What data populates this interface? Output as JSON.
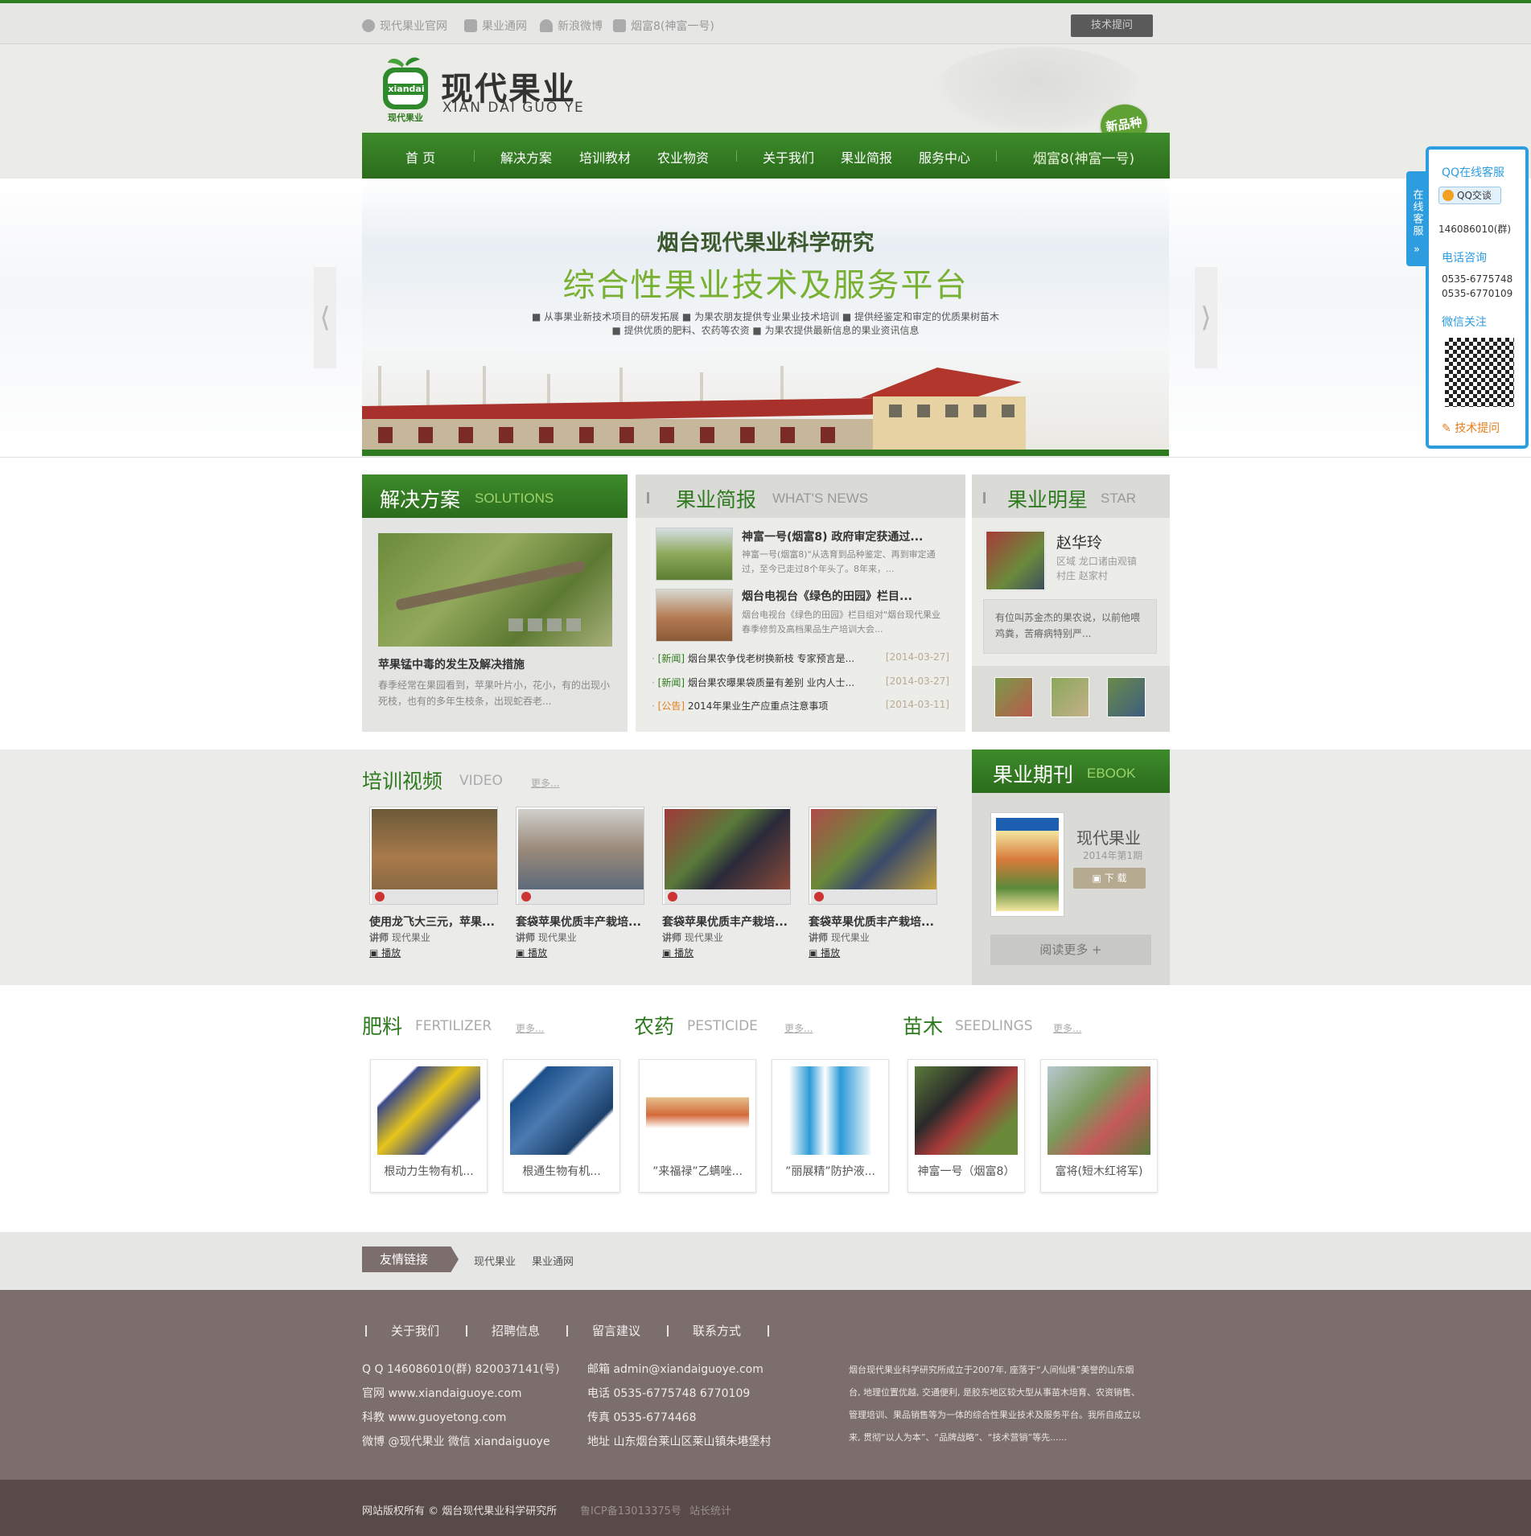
{
  "topbar": {
    "links": [
      "现代果业官网",
      "果业通网",
      "新浪微博",
      "烟富8(神富一号)"
    ],
    "tech_button": "技术提问"
  },
  "header": {
    "logo_mark": "xiandai",
    "logo_mark_sub": "现代果业",
    "logo_title": "现代果业",
    "logo_subtitle": "XIAN DAI GUO YE",
    "badge": "新品种"
  },
  "nav": {
    "items": [
      "首 页",
      "解决方案",
      "培训教材",
      "农业物资",
      "关于我们",
      "果业简报",
      "服务中心"
    ],
    "featured": "烟富8(神富一号)"
  },
  "banner": {
    "title": "烟台现代果业科学研究",
    "headline": "综合性果业技术及服务平台",
    "line1": "■ 从事果业新技术项目的研发拓展   ■ 为果农朋友提供专业果业技术培训   ■ 提供经鉴定和审定的优质果树苗木",
    "line2": "■ 提供优质的肥料、农药等农资   ■ 为果农提供最新信息的果业资讯信息",
    "prev": "⟨",
    "next": "⟩"
  },
  "solutions": {
    "title": "解决方案",
    "en": "SOLUTIONS",
    "article_title": "苹果锰中毒的发生及解决措施",
    "article_desc": "春季经常在果园看到，苹果叶片小，花小，有的出现小死枝，也有的多年生枝条，出现蛇吞老..."
  },
  "news": {
    "title": "果业简报",
    "en": "WHAT'S NEWS",
    "featured": [
      {
        "title": "神富一号(烟富8) 政府审定获通过...",
        "desc": "神富一号(烟富8)\"从选育到品种鉴定、再到审定通过，至今已走过8个年头了。8年来，..."
      },
      {
        "title": "烟台电视台《绿色的田园》栏目...",
        "desc": "烟台电视台《绿色的田园》栏目组对\"烟台现代果业春季修剪及高档果品生产培训大会..."
      }
    ],
    "list": [
      {
        "tag": "[新闻]",
        "text": "烟台果农争伐老树换新枝 专家预言是...",
        "date": "[2014-03-27]"
      },
      {
        "tag": "[新闻]",
        "text": "烟台果农曝果袋质量有差别 业内人士...",
        "date": "[2014-03-27]"
      },
      {
        "tag": "[公告]",
        "text": "2014年果业生产应重点注意事项",
        "date": "[2014-03-11]"
      }
    ]
  },
  "star": {
    "title": "果业明星",
    "en": "STAR",
    "name": "赵华玲",
    "region_label": "区域",
    "region": "龙口诸由观镇",
    "village_label": "村庄",
    "village": "赵家村",
    "quote": "有位叫苏金杰的果农说，以前他喂鸡粪，苦瘠病特别严..."
  },
  "video": {
    "title": "培训视频",
    "en": "VIDEO",
    "more": "更多...",
    "items": [
      {
        "title": "使用龙飞大三元，苹果...",
        "lecturer_label": "讲师",
        "lecturer": "现代果业",
        "play": "播放"
      },
      {
        "title": "套袋苹果优质丰产栽培...",
        "lecturer_label": "讲师",
        "lecturer": "现代果业",
        "play": "播放"
      },
      {
        "title": "套袋苹果优质丰产栽培...",
        "lecturer_label": "讲师",
        "lecturer": "现代果业",
        "play": "播放"
      },
      {
        "title": "套袋苹果优质丰产栽培...",
        "lecturer_label": "讲师",
        "lecturer": "现代果业",
        "play": "播放"
      }
    ]
  },
  "ebook": {
    "title": "果业期刊",
    "en": "EBOOK",
    "name": "现代果业",
    "issue": "2014年第1期",
    "download": "下 载",
    "more": "阅读更多 +"
  },
  "products": {
    "fertilizer": {
      "title": "肥料",
      "en": "FERTILIZER",
      "more": "更多..."
    },
    "pesticide": {
      "title": "农药",
      "en": "PESTICIDE",
      "more": "更多..."
    },
    "seedlings": {
      "title": "苗木",
      "en": "SEEDLINGS",
      "more": "更多..."
    },
    "items": [
      "根动力生物有机...",
      "根通生物有机...",
      "”来福禄”乙螨唑...",
      "”丽展精”防护液...",
      "神富一号（烟富8）",
      "富将(短木红将军)"
    ]
  },
  "friend_links": {
    "label": "友情链接",
    "links": [
      "现代果业",
      "果业通网"
    ]
  },
  "footer": {
    "nav": [
      "关于我们",
      "招聘信息",
      "留言建议",
      "联系方式"
    ],
    "col1": [
      "Q Q  146086010(群)  820037141(号)",
      "官网  www.xiandaiguoye.com",
      "科教  www.guoyetong.com",
      "微博  @现代果业   微信  xiandaiguoye"
    ],
    "col2": [
      "邮箱  admin@xiandaiguoye.com",
      "电话  0535-6775748  6770109",
      "传真  0535-6774468",
      "地址  山东烟台莱山区莱山镇朱塂堡村"
    ],
    "about": [
      "烟台现代果业科学研究所成立于2007年, 座落于“人间仙境”美誉的山东烟",
      "台, 地理位置优越, 交通便利, 是胶东地区较大型从事苗木培育、农资销售、",
      "管理培训、果品销售等为一体的综合性果业技术及服务平台。我所自成立以",
      "来, 贯彻“以人为本”、“品牌战略”、“技术营销”等先......"
    ],
    "copyright": "网站版权所有 © 烟台现代果业科学研究所",
    "icp": "鲁ICP备13013375号",
    "stats": "站长统计"
  },
  "side": {
    "tab": "在线客服",
    "qq_title": "QQ在线客服",
    "qq_button": "QQ交谈",
    "qq_group": "146086010(群)",
    "phone_title": "电话咨询",
    "phone1": "0535-6775748",
    "phone2": "0535-6770109",
    "wechat_title": "微信关注",
    "ask": "技术提问"
  },
  "colors": {
    "brand_green": "#2e7a1e",
    "nav_green": "#3d8b2b",
    "side_blue": "#2d9de0",
    "footer": "#7b6e6c"
  }
}
